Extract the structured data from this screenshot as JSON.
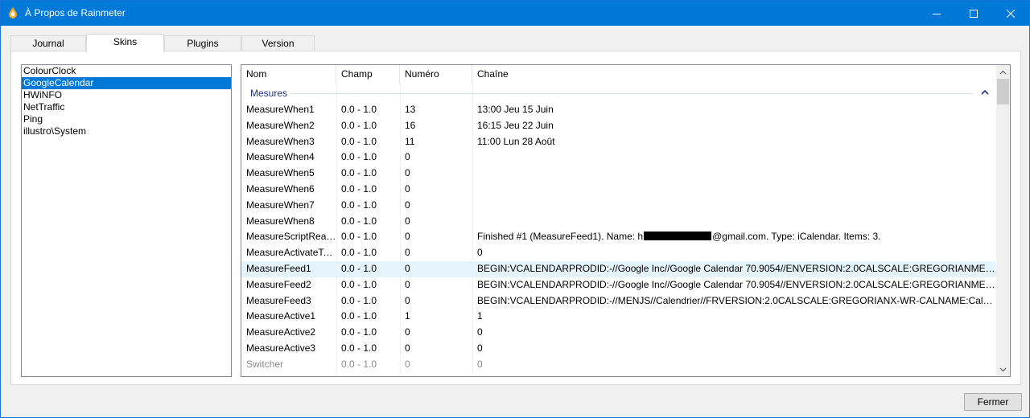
{
  "window": {
    "title": "À Propos de Rainmeter",
    "icon": "rainmeter-drop-icon",
    "accent": "#0078d7"
  },
  "tabs": [
    {
      "label": "Journal"
    },
    {
      "label": "Skins"
    },
    {
      "label": "Plugins"
    },
    {
      "label": "Version"
    }
  ],
  "skins": [
    {
      "label": "ColourClock"
    },
    {
      "label": "GoogleCalendar"
    },
    {
      "label": "HWiNFO"
    },
    {
      "label": "NetTraffic"
    },
    {
      "label": "Ping"
    },
    {
      "label": "illustro\\System"
    }
  ],
  "table": {
    "columns": [
      "Nom",
      "Champ",
      "Numéro",
      "Chaîne"
    ],
    "group_label": "Mesures",
    "rows": [
      {
        "nom": "MeasureWhen1",
        "champ": "0.0 - 1.0",
        "numero": "13",
        "chaine": "13:00 Jeu 15 Juin"
      },
      {
        "nom": "MeasureWhen2",
        "champ": "0.0 - 1.0",
        "numero": "16",
        "chaine": "16:15 Jeu 22 Juin"
      },
      {
        "nom": "MeasureWhen3",
        "champ": "0.0 - 1.0",
        "numero": "11",
        "chaine": "11:00 Lun 28 Août"
      },
      {
        "nom": "MeasureWhen4",
        "champ": "0.0 - 1.0",
        "numero": "0",
        "chaine": ""
      },
      {
        "nom": "MeasureWhen5",
        "champ": "0.0 - 1.0",
        "numero": "0",
        "chaine": ""
      },
      {
        "nom": "MeasureWhen6",
        "champ": "0.0 - 1.0",
        "numero": "0",
        "chaine": ""
      },
      {
        "nom": "MeasureWhen7",
        "champ": "0.0 - 1.0",
        "numero": "0",
        "chaine": ""
      },
      {
        "nom": "MeasureWhen8",
        "champ": "0.0 - 1.0",
        "numero": "0",
        "chaine": ""
      },
      {
        "nom": "MeasureScriptRead...",
        "champ": "0.0 - 1.0",
        "numero": "0",
        "chaine_prefix": "Finished #1 (MeasureFeed1). Name: h",
        "chaine_suffix": "@gmail.com. Type: iCalendar. Items: 3."
      },
      {
        "nom": "MeasureActivateTa...",
        "champ": "0.0 - 1.0",
        "numero": "0",
        "chaine": "0"
      },
      {
        "nom": "MeasureFeed1",
        "champ": "0.0 - 1.0",
        "numero": "0",
        "chaine": "BEGIN:VCALENDARPRODID:-//Google Inc//Google Calendar 70.9054//ENVERSION:2.0CALSCALE:GREGORIANMETHOD:..."
      },
      {
        "nom": "MeasureFeed2",
        "champ": "0.0 - 1.0",
        "numero": "0",
        "chaine": "BEGIN:VCALENDARPRODID:-//Google Inc//Google Calendar 70.9054//ENVERSION:2.0CALSCALE:GREGORIANMETHOD:..."
      },
      {
        "nom": "MeasureFeed3",
        "champ": "0.0 - 1.0",
        "numero": "0",
        "chaine": "BEGIN:VCALENDARPRODID:-//MENJS//Calendrier//FRVERSION:2.0CALSCALE:GREGORIANX-WR-CALNAME:Calendrier ..."
      },
      {
        "nom": "MeasureActive1",
        "champ": "0.0 - 1.0",
        "numero": "1",
        "chaine": "1"
      },
      {
        "nom": "MeasureActive2",
        "champ": "0.0 - 1.0",
        "numero": "0",
        "chaine": "0"
      },
      {
        "nom": "MeasureActive3",
        "champ": "0.0 - 1.0",
        "numero": "0",
        "chaine": "0"
      },
      {
        "nom": "Switcher",
        "champ": "0.0 - 1.0",
        "numero": "0",
        "chaine": "0"
      }
    ]
  },
  "buttons": {
    "close_label": "Fermer"
  }
}
